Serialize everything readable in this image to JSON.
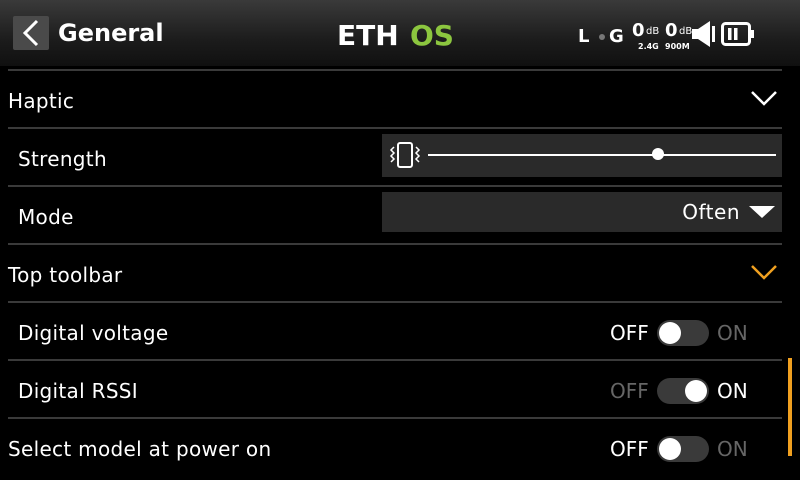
{
  "header": {
    "title": "General",
    "logo": {
      "part1": "ETH",
      "part2": "OS"
    },
    "status": {
      "l_label": "L",
      "g_label": "G",
      "rssi1_value": "0",
      "rssi1_unit": "dB",
      "rssi1_band": "2.4G",
      "rssi2_value": "0",
      "rssi2_unit": "dB",
      "rssi2_band": "900M"
    }
  },
  "sections": {
    "haptic": {
      "label": "Haptic",
      "strength": {
        "label": "Strength",
        "value_fraction": 0.66
      },
      "mode": {
        "label": "Mode",
        "value": "Often"
      }
    },
    "top_toolbar": {
      "label": "Top toolbar",
      "digital_voltage": {
        "label": "Digital voltage",
        "off": "OFF",
        "on": "ON",
        "state": "off"
      },
      "digital_rssi": {
        "label": "Digital RSSI",
        "off": "OFF",
        "on": "ON",
        "state": "on"
      }
    },
    "select_model": {
      "label": "Select model at power on",
      "off": "OFF",
      "on": "ON",
      "state": "off"
    }
  },
  "colors": {
    "accent": "#f0a020",
    "logo_green": "#8cc63f",
    "background": "#000000",
    "field": "#2a2a2a"
  }
}
